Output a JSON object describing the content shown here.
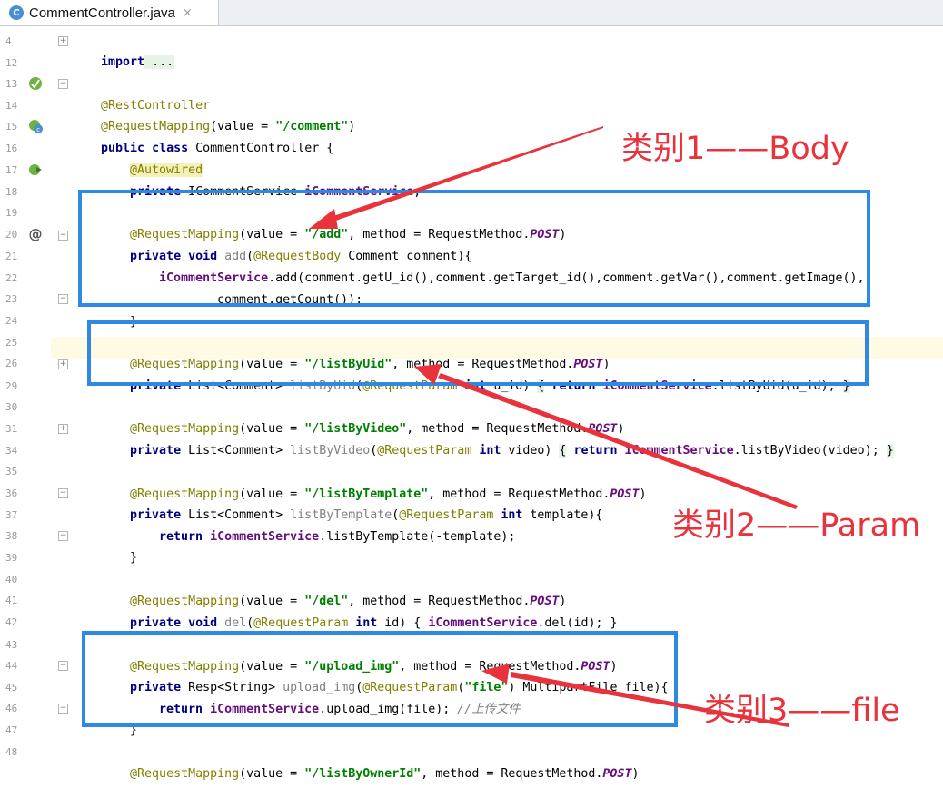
{
  "tab": {
    "title": "CommentController.java",
    "icon_letter": "C",
    "close": "×"
  },
  "line_numbers": [
    "4",
    "12",
    "13",
    "14",
    "15",
    "16",
    "17",
    "18",
    "19",
    "20",
    "21",
    "22",
    "23",
    "24",
    "25",
    "26",
    "29",
    "30",
    "31",
    "34",
    "35",
    "36",
    "37",
    "38",
    "39",
    "40",
    "41",
    "42",
    "43",
    "44",
    "45",
    "46",
    "47",
    "48"
  ],
  "code": {
    "l4": {
      "kw": "import",
      "rest": " ..."
    },
    "l13": {
      "ann": "@RestController"
    },
    "l14": {
      "ann": "@RequestMapping",
      "p1": "(value = ",
      "str": "\"/comment\"",
      "p2": ")"
    },
    "l15": {
      "kw": "public class",
      "rest": " CommentController {"
    },
    "l16": {
      "ann": "@Autowired"
    },
    "l17": {
      "kw": "private",
      "rest": " ICommentService ",
      "fld": "iCommentService",
      "end": ";"
    },
    "l19": {
      "ann": "@RequestMapping",
      "p1": "(value = ",
      "str": "\"/add\"",
      "p2": ", method = RequestMethod.",
      "ital": "POST",
      "p3": ")"
    },
    "l20": {
      "kw": "private void",
      "sp": " ",
      "unused": "add",
      "p1": "(",
      "ann": "@RequestBody",
      "rest": " Comment comment){"
    },
    "l21": {
      "fld": "iCommentService",
      "rest": ".add(comment.getU_id(),comment.getTarget_id(),comment.getVar(),comment.getImage(),"
    },
    "l22": {
      "rest": "comment.getCount());"
    },
    "l23": {
      "rest": "}"
    },
    "l25": {
      "ann": "@RequestMapping",
      "p1": "(value = ",
      "str": "\"/listByUid\"",
      "p2": ", method = RequestMethod.",
      "ital": "POST",
      "p3": ")"
    },
    "l26": {
      "kw": "private",
      "p1": " List<Comment> ",
      "unused": "listByUid",
      "p2": "(",
      "ann": "@RequestParam",
      "kw2": " int",
      "p3": " u_id) ",
      "b1": "{",
      "sp": " ",
      "kw3": "return",
      "sp2": " ",
      "fld": "iCommentService",
      "p4": ".listByUid(u_id); ",
      "b2": "}"
    },
    "l30": {
      "ann": "@RequestMapping",
      "p1": "(value = ",
      "str": "\"/listByVideo\"",
      "p2": ", method = RequestMethod.",
      "ital": "POST",
      "p3": ")"
    },
    "l31": {
      "kw": "private",
      "p1": " List<Comment> ",
      "unused": "listByVideo",
      "p2": "(",
      "ann": "@RequestParam",
      "kw2": " int",
      "p3": " video) ",
      "b1": "{",
      "sp": " ",
      "kw3": "return",
      "sp2": " ",
      "fld": "iCommentService",
      "p4": ".listByVideo(video); ",
      "b2": "}"
    },
    "l35": {
      "ann": "@RequestMapping",
      "p1": "(value = ",
      "str": "\"/listByTemplate\"",
      "p2": ", method = RequestMethod.",
      "ital": "POST",
      "p3": ")"
    },
    "l36": {
      "kw": "private",
      "p1": " List<Comment> ",
      "unused": "listByTemplate",
      "p2": "(",
      "ann": "@RequestParam",
      "kw2": " int",
      "p3": " template){"
    },
    "l37": {
      "kw": "return",
      "sp": " ",
      "fld": "iCommentService",
      "rest": ".listByTemplate(-template);"
    },
    "l38": {
      "rest": "}"
    },
    "l40": {
      "ann": "@RequestMapping",
      "p1": "(value = ",
      "str": "\"/del\"",
      "p2": ", method = RequestMethod.",
      "ital": "POST",
      "p3": ")"
    },
    "l41": {
      "kw": "private void",
      "sp": " ",
      "unused": "del",
      "p1": "(",
      "ann": "@RequestParam",
      "kw2": " int",
      "p2": " id) { ",
      "fld": "iCommentService",
      "p3": ".del(id); }"
    },
    "l43": {
      "ann": "@RequestMapping",
      "p1": "(value = ",
      "str": "\"/upload_img\"",
      "p2": ", method = RequestMethod.",
      "ital": "POST",
      "p3": ")"
    },
    "l44": {
      "kw": "private",
      "p1": " Resp<String> ",
      "unused": "upload_img",
      "p2": "(",
      "ann": "@RequestParam",
      "p3": "(",
      "str": "\"file\"",
      "p4": ") MultipartFile file){"
    },
    "l45": {
      "kw": "return",
      "sp": " ",
      "fld": "iCommentService",
      "rest": ".upload_img(file); ",
      "cmt": "//上传文件"
    },
    "l46": {
      "rest": "}"
    },
    "l48": {
      "ann": "@RequestMapping",
      "p1": "(value = ",
      "str": "\"/listByOwnerId\"",
      "p2": ", method = RequestMethod.",
      "ital": "POST",
      "p3": ")"
    }
  },
  "annotations": {
    "label1": "类别1——Body",
    "label2": "类别2——Param",
    "label3": "类别3——file"
  },
  "colors": {
    "annotation_red": "#e8323c",
    "box_blue": "#2d8ae0",
    "current_line": "#fffae3"
  }
}
